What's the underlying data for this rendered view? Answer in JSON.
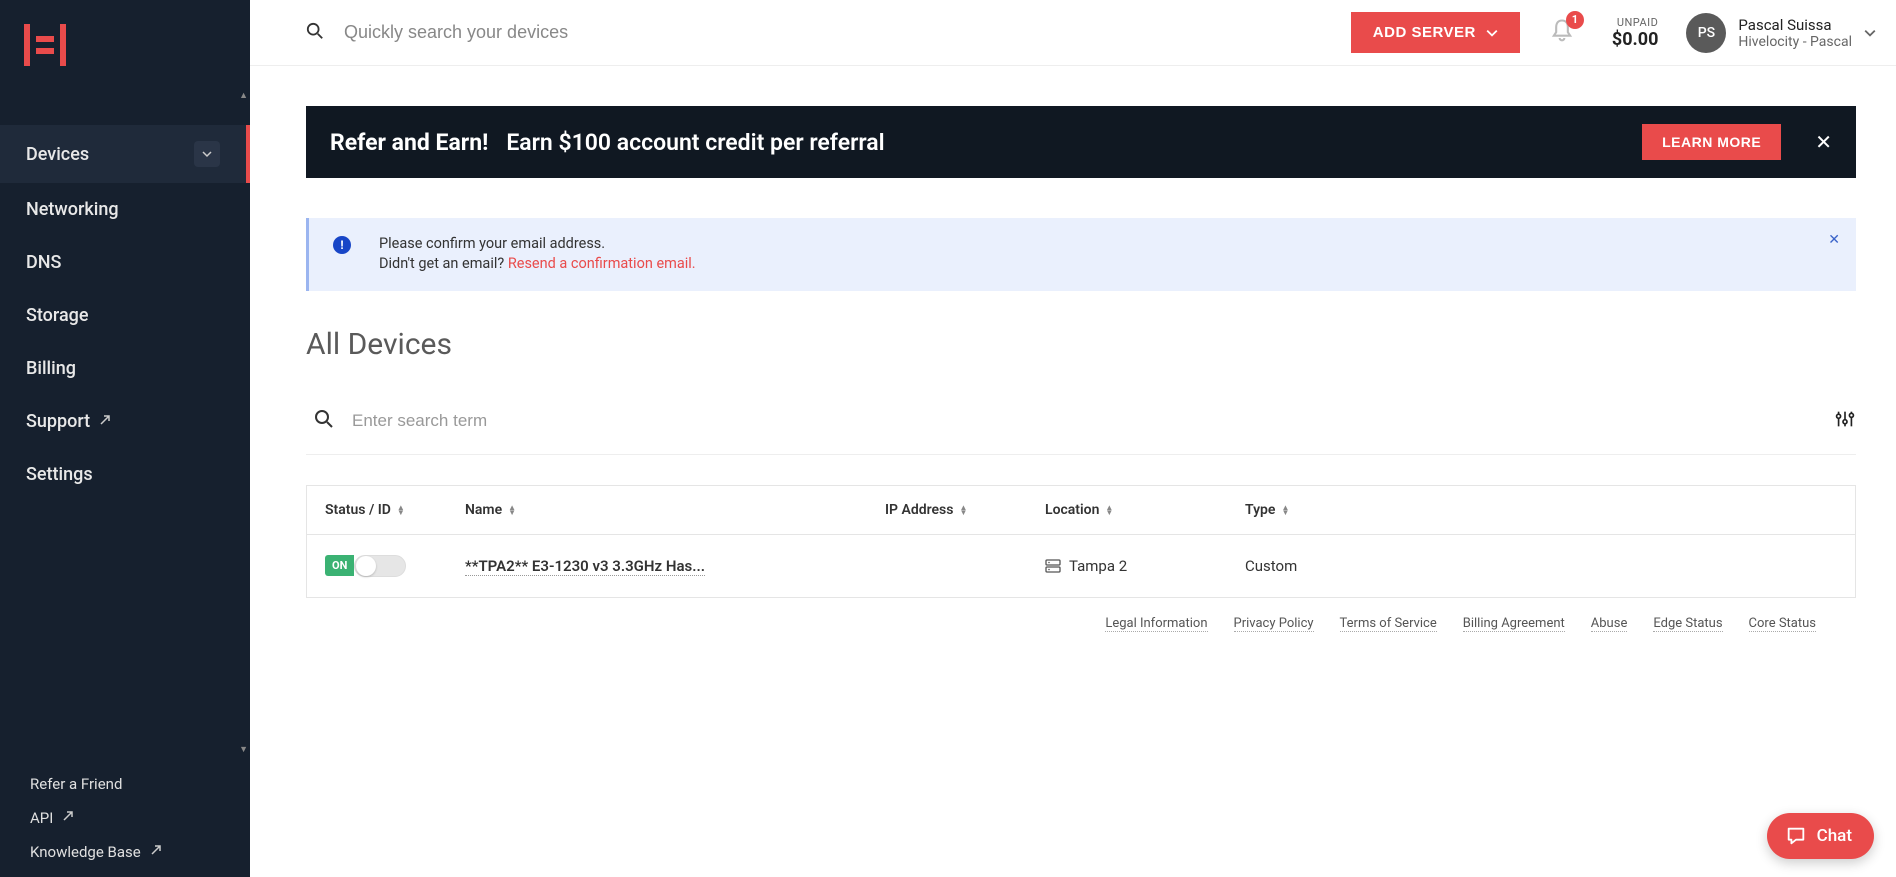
{
  "colors": {
    "accent": "#e94b4b",
    "sidebar": "#16202e",
    "banner": "#101822",
    "notice_bg": "#eaf0fd",
    "success": "#3bb273"
  },
  "header": {
    "search_placeholder": "Quickly search your devices",
    "add_server_label": "ADD SERVER",
    "notification_count": "1",
    "unpaid_label": "UNPAID",
    "unpaid_amount": "$0.00",
    "avatar_initials": "PS",
    "user_name": "Pascal Suissa",
    "user_org": "Hivelocity - Pascal"
  },
  "sidebar": {
    "items": [
      {
        "label": "Devices",
        "expandable": true,
        "active": true
      },
      {
        "label": "Networking"
      },
      {
        "label": "DNS"
      },
      {
        "label": "Storage"
      },
      {
        "label": "Billing"
      },
      {
        "label": "Support",
        "external": true
      },
      {
        "label": "Settings"
      }
    ],
    "bottom": [
      {
        "label": "Refer a Friend"
      },
      {
        "label": "API",
        "external": true
      },
      {
        "label": "Knowledge Base",
        "external": true
      }
    ]
  },
  "refer": {
    "title": "Refer and Earn!",
    "subtitle": "Earn $100 account credit per referral",
    "learn_label": "LEARN MORE"
  },
  "notice": {
    "line1": "Please confirm your email address.",
    "line2a": "Didn't get an email? ",
    "link": "Resend a confirmation email."
  },
  "page_title": "All Devices",
  "device_search_placeholder": "Enter search term",
  "table": {
    "headers": {
      "status": "Status / ID",
      "name": "Name",
      "ip": "IP Address",
      "location": "Location",
      "type": "Type"
    },
    "rows": [
      {
        "status_badge": "ON",
        "name": "**TPA2** E3-1230 v3 3.3GHz Has...",
        "ip": "",
        "location": "Tampa 2",
        "type": "Custom"
      }
    ]
  },
  "footer": {
    "links": [
      "Legal Information",
      "Privacy Policy",
      "Terms of Service",
      "Billing Agreement",
      "Abuse",
      "Edge Status",
      "Core Status"
    ]
  },
  "chat_label": "Chat"
}
